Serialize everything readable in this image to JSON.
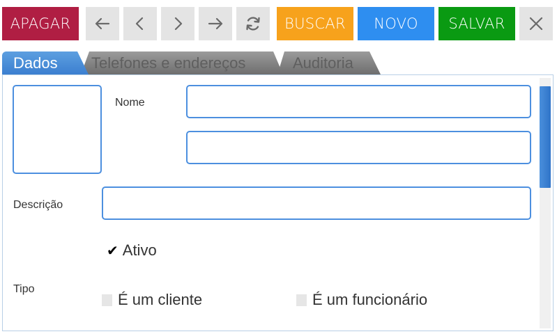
{
  "toolbar": {
    "delete_label": "APAGAR",
    "search_label": "BUSCAR",
    "new_label": "NOVO",
    "save_label": "SALVAR",
    "colors": {
      "delete": "#b01e43",
      "search": "#f7a21c",
      "new": "#2e8ef0",
      "save": "#0a9a12",
      "nav": "#e4e4e4"
    },
    "icons": [
      "arrow-left-icon",
      "chevron-left-icon",
      "chevron-right-icon",
      "arrow-right-icon",
      "refresh-icon",
      "close-icon"
    ]
  },
  "tabs": [
    {
      "label": "Dados",
      "active": true
    },
    {
      "label": "Telefones e endereços",
      "active": false
    },
    {
      "label": "Auditoria",
      "active": false
    }
  ],
  "form": {
    "name_label": "Nome",
    "name_value": "",
    "name2_value": "",
    "description_label": "Descrição",
    "description_value": "",
    "active_label": "Ativo",
    "active_checked": true,
    "type_label": "Tipo",
    "client_label": "É um cliente",
    "client_checked": false,
    "employee_label": "É um funcionário",
    "employee_checked": false
  }
}
